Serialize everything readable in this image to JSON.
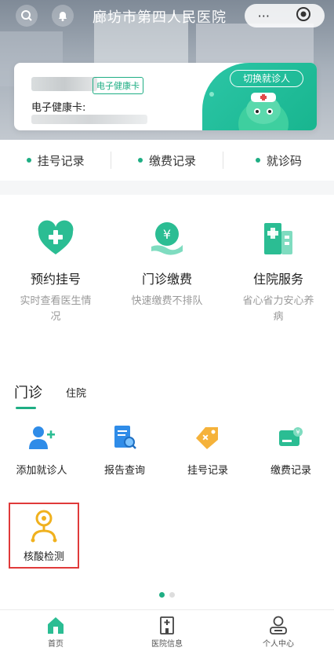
{
  "header": {
    "title": "廊坊市第四人民医院",
    "left_icons": [
      "search-icon",
      "bell-icon"
    ],
    "capsule": {
      "more": "···",
      "close_icon": "record-icon"
    }
  },
  "health_card": {
    "tag": "电子健康卡",
    "card_label": "电子健康卡:",
    "switch_label": "切换就诊人",
    "accent": "#1fae84"
  },
  "quick_links": [
    {
      "label": "挂号记录"
    },
    {
      "label": "缴费记录"
    },
    {
      "label": "就诊码"
    }
  ],
  "services": [
    {
      "name": "预约挂号",
      "desc": "实时查看医生情况",
      "icon": "heart-plus-icon"
    },
    {
      "name": "门诊缴费",
      "desc": "快速缴费不排队",
      "icon": "yen-hand-icon"
    },
    {
      "name": "住院服务",
      "desc": "省心省力安心养病",
      "icon": "hospital-building-icon"
    }
  ],
  "tabs": {
    "active": "门诊",
    "inactive": "住院"
  },
  "grid_items": [
    {
      "label": "添加就诊人",
      "icon": "add-user-icon"
    },
    {
      "label": "报告查询",
      "icon": "report-search-icon"
    },
    {
      "label": "挂号记录",
      "icon": "tag-icon"
    },
    {
      "label": "缴费记录",
      "icon": "payment-card-icon"
    }
  ],
  "highlight_item": {
    "label": "核酸检测",
    "icon": "nucleic-test-icon"
  },
  "bottom_nav": [
    {
      "label": "首页",
      "icon": "home-icon"
    },
    {
      "label": "医院信息",
      "icon": "hospital-icon"
    },
    {
      "label": "个人中心",
      "icon": "user-icon"
    }
  ]
}
